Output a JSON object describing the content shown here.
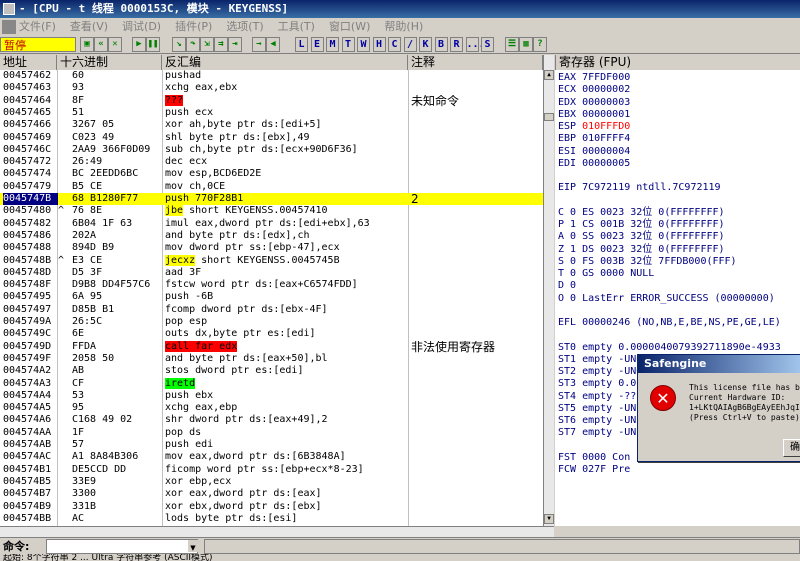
{
  "window": {
    "title": "- [CPU - t 线程 0000153C, 模块 - KEYGENSS]"
  },
  "menu": [
    "文件(F)",
    "查看(V)",
    "调试(D)",
    "插件(P)",
    "选项(T)",
    "工具(T)",
    "窗口(W)",
    "帮助(H)"
  ],
  "toolbar": {
    "status": "暂停",
    "letters": [
      "L",
      "E",
      "M",
      "T",
      "W",
      "H",
      "C",
      "/",
      "K",
      "B",
      "R",
      "...",
      "S"
    ]
  },
  "disasm": {
    "headers": {
      "addr": "地址",
      "hex": "十六进制",
      "asm": "反汇编",
      "comment": "注释"
    },
    "rows": [
      {
        "addr": "00457462",
        "arrow": "",
        "hex": "60",
        "asm": "pushad",
        "cmt": "",
        "hl": ""
      },
      {
        "addr": "00457463",
        "arrow": "",
        "hex": "93",
        "asm": "xchg eax,ebx",
        "cmt": "",
        "hl": ""
      },
      {
        "addr": "00457464",
        "arrow": "",
        "hex": "8F",
        "asm": "???",
        "cmt": "未知命令",
        "hl": "red"
      },
      {
        "addr": "00457465",
        "arrow": "",
        "hex": "51",
        "asm": "push ecx",
        "cmt": "",
        "hl": ""
      },
      {
        "addr": "00457466",
        "arrow": "",
        "hex": "3267 05",
        "asm": "xor ah,byte ptr ds:[edi+5]",
        "cmt": "",
        "hl": ""
      },
      {
        "addr": "00457469",
        "arrow": "",
        "hex": "C023 49",
        "asm": "shl byte ptr ds:[ebx],49",
        "cmt": "",
        "hl": ""
      },
      {
        "addr": "0045746C",
        "arrow": "",
        "hex": "2AA9 366F0D09",
        "asm": "sub ch,byte ptr ds:[ecx+90D6F36]",
        "cmt": "",
        "hl": ""
      },
      {
        "addr": "00457472",
        "arrow": "",
        "hex": "26:49",
        "asm": "dec ecx",
        "cmt": "",
        "hl": ""
      },
      {
        "addr": "00457474",
        "arrow": "",
        "hex": "BC 2EEDD6BC",
        "asm": "mov esp,BCD6ED2E",
        "cmt": "",
        "hl": ""
      },
      {
        "addr": "00457479",
        "arrow": "",
        "hex": "B5 CE",
        "asm": "mov ch,0CE",
        "cmt": "",
        "hl": ""
      },
      {
        "addr": "0045747B",
        "arrow": "",
        "hex": "68 B1280F77",
        "asm": "push 770F28B1",
        "cmt": "2",
        "hl": "sel"
      },
      {
        "addr": "00457480",
        "arrow": "^",
        "hex": "76 8E",
        "asm": "jbe short KEYGENSS.00457410",
        "cmt": "",
        "hl": "jmp"
      },
      {
        "addr": "00457482",
        "arrow": "",
        "hex": "6B04 1F 63",
        "asm": "imul eax,dword ptr ds:[edi+ebx],63",
        "cmt": "",
        "hl": ""
      },
      {
        "addr": "00457486",
        "arrow": "",
        "hex": "202A",
        "asm": "and byte ptr ds:[edx],ch",
        "cmt": "",
        "hl": ""
      },
      {
        "addr": "00457488",
        "arrow": "",
        "hex": "894D B9",
        "asm": "mov dword ptr ss:[ebp-47],ecx",
        "cmt": "",
        "hl": ""
      },
      {
        "addr": "0045748B",
        "arrow": "^",
        "hex": "E3 CE",
        "asm": "jecxz short KEYGENSS.0045745B",
        "cmt": "",
        "hl": "jmp"
      },
      {
        "addr": "0045748D",
        "arrow": "",
        "hex": "D5 3F",
        "asm": "aad 3F",
        "cmt": "",
        "hl": ""
      },
      {
        "addr": "0045748F",
        "arrow": "",
        "hex": "D9B8 DD4F57C6",
        "asm": "fstcw word ptr ds:[eax+C6574FDD]",
        "cmt": "",
        "hl": ""
      },
      {
        "addr": "00457495",
        "arrow": "",
        "hex": "6A 95",
        "asm": "push -6B",
        "cmt": "",
        "hl": ""
      },
      {
        "addr": "00457497",
        "arrow": "",
        "hex": "D85B B1",
        "asm": "fcomp dword ptr ds:[ebx-4F]",
        "cmt": "",
        "hl": ""
      },
      {
        "addr": "0045749A",
        "arrow": "",
        "hex": "26:5C",
        "asm": "pop esp",
        "cmt": "",
        "hl": ""
      },
      {
        "addr": "0045749C",
        "arrow": "",
        "hex": "6E",
        "asm": "outs dx,byte ptr es:[edi]",
        "cmt": "",
        "hl": ""
      },
      {
        "addr": "0045749D",
        "arrow": "",
        "hex": "FFDA",
        "asm": "call far edx",
        "cmt": "非法使用寄存器",
        "hl": "red"
      },
      {
        "addr": "0045749F",
        "arrow": "",
        "hex": "2058 50",
        "asm": "and byte ptr ds:[eax+50],bl",
        "cmt": "",
        "hl": ""
      },
      {
        "addr": "004574A2",
        "arrow": "",
        "hex": "AB",
        "asm": "stos dword ptr es:[edi]",
        "cmt": "",
        "hl": ""
      },
      {
        "addr": "004574A3",
        "arrow": "",
        "hex": "CF",
        "asm": "iretd",
        "cmt": "",
        "hl": "green"
      },
      {
        "addr": "004574A4",
        "arrow": "",
        "hex": "53",
        "asm": "push ebx",
        "cmt": "",
        "hl": ""
      },
      {
        "addr": "004574A5",
        "arrow": "",
        "hex": "95",
        "asm": "xchg eax,ebp",
        "cmt": "",
        "hl": ""
      },
      {
        "addr": "004574A6",
        "arrow": "",
        "hex": "C168 49 02",
        "asm": "shr dword ptr ds:[eax+49],2",
        "cmt": "",
        "hl": ""
      },
      {
        "addr": "004574AA",
        "arrow": "",
        "hex": "1F",
        "asm": "pop ds",
        "cmt": "",
        "hl": ""
      },
      {
        "addr": "004574AB",
        "arrow": "",
        "hex": "57",
        "asm": "push edi",
        "cmt": "",
        "hl": ""
      },
      {
        "addr": "004574AC",
        "arrow": "",
        "hex": "A1 8A84B306",
        "asm": "mov eax,dword ptr ds:[6B3848A]",
        "cmt": "",
        "hl": ""
      },
      {
        "addr": "004574B1",
        "arrow": "",
        "hex": "DE5CCD DD",
        "asm": "ficomp word ptr ss:[ebp+ecx*8-23]",
        "cmt": "",
        "hl": ""
      },
      {
        "addr": "004574B5",
        "arrow": "",
        "hex": "33E9",
        "asm": "xor ebp,ecx",
        "cmt": "",
        "hl": ""
      },
      {
        "addr": "004574B7",
        "arrow": "",
        "hex": "3300",
        "asm": "xor eax,dword ptr ds:[eax]",
        "cmt": "",
        "hl": ""
      },
      {
        "addr": "004574B9",
        "arrow": "",
        "hex": "331B",
        "asm": "xor ebx,dword ptr ds:[ebx]",
        "cmt": "",
        "hl": ""
      },
      {
        "addr": "004574BB",
        "arrow": "",
        "hex": "AC",
        "asm": "lods byte ptr ds:[esi]",
        "cmt": "",
        "hl": ""
      }
    ]
  },
  "registers": {
    "header": "寄存器 (FPU)",
    "lines": [
      {
        "t": "EAX 7FFDF000",
        "red": false
      },
      {
        "t": "ECX 00000002",
        "red": false
      },
      {
        "t": "EDX 00000003",
        "red": false
      },
      {
        "t": "EBX 00000001",
        "red": false
      },
      {
        "t": "ESP 010FFFD0",
        "red": true
      },
      {
        "t": "EBP 010FFFF4",
        "red": false
      },
      {
        "t": "ESI 00000004",
        "red": false
      },
      {
        "t": "EDI 00000005",
        "red": false
      },
      {
        "t": "",
        "red": false
      },
      {
        "t": "EIP 7C972119 ntdll.7C972119",
        "red": false
      },
      {
        "t": "",
        "red": false
      },
      {
        "t": "C 0  ES 0023 32位 0(FFFFFFFF)",
        "red": false
      },
      {
        "t": "P 1  CS 001B 32位 0(FFFFFFFF)",
        "red": false
      },
      {
        "t": "A 0  SS 0023 32位 0(FFFFFFFF)",
        "red": false
      },
      {
        "t": "Z 1  DS 0023 32位 0(FFFFFFFF)",
        "red": false
      },
      {
        "t": "S 0  FS 003B 32位 7FFDB000(FFF)",
        "red": false
      },
      {
        "t": "T 0  GS 0000 NULL",
        "red": false
      },
      {
        "t": "D 0",
        "red": false
      },
      {
        "t": "O 0  LastErr ERROR_SUCCESS (00000000)",
        "red": false
      },
      {
        "t": "",
        "red": false
      },
      {
        "t": "EFL 00000246 (NO,NB,E,BE,NS,PE,GE,LE)",
        "red": false
      },
      {
        "t": "",
        "red": false
      },
      {
        "t": "ST0 empty 0.0000040079392711890e-4933",
        "red": false
      },
      {
        "t": "ST1 empty -UNORM E920 0012D6B4 7C836490",
        "red": false
      },
      {
        "t": "ST2 empty -UNORM 8ECB 7C9301DB FFFFFFFF",
        "red": false
      },
      {
        "t": "ST3 empty 0.0",
        "red": false
      },
      {
        "t": "ST4 empty -??",
        "red": false
      },
      {
        "t": "ST5 empty -UN",
        "red": false
      },
      {
        "t": "ST6 empty -UN",
        "red": false
      },
      {
        "t": "ST7 empty -UN",
        "red": false
      },
      {
        "t": "",
        "red": false
      },
      {
        "t": "FST 0000  Con",
        "red": false
      },
      {
        "t": "FCW 027F  Pre",
        "red": false
      }
    ]
  },
  "command": {
    "label": "命令:",
    "value": ""
  },
  "statusbar": "起始: 8个字符串 2 ... Ultra 字符串参考 (ASCII模式)",
  "dialog": {
    "title": "Safengine",
    "lines": [
      "This license file has be",
      "Current Hardware ID:",
      "1+LKtQAIAgB6BgEAyEEhJqIq",
      "(Press Ctrl+V to paste)"
    ],
    "ok": "确"
  }
}
